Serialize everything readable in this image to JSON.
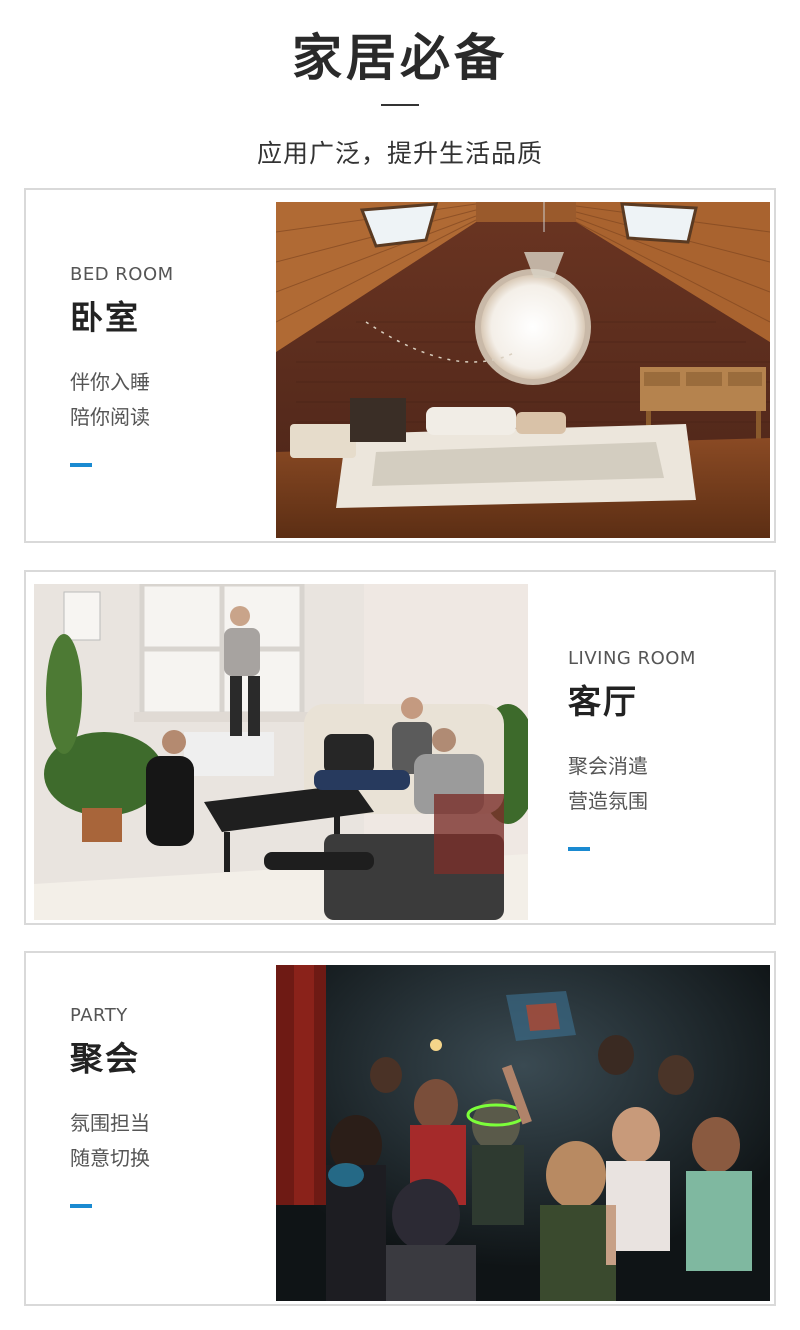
{
  "header": {
    "title": "家居必备",
    "subtitle": "应用广泛，提升生活品质"
  },
  "accent_color": "#1a8ad1",
  "sections": [
    {
      "en": "BED ROOM",
      "cn": "卧室",
      "lines": [
        "伴你入睡",
        "陪你阅读"
      ],
      "image": "attic-bedroom-photo"
    },
    {
      "en": "LIVING ROOM",
      "cn": "客厅",
      "lines": [
        "聚会消遣",
        "营造氛围"
      ],
      "image": "living-room-friends-photo"
    },
    {
      "en": "PARTY",
      "cn": "聚会",
      "lines": [
        "氛围担当",
        "随意切换"
      ],
      "image": "party-crowd-photo"
    }
  ]
}
